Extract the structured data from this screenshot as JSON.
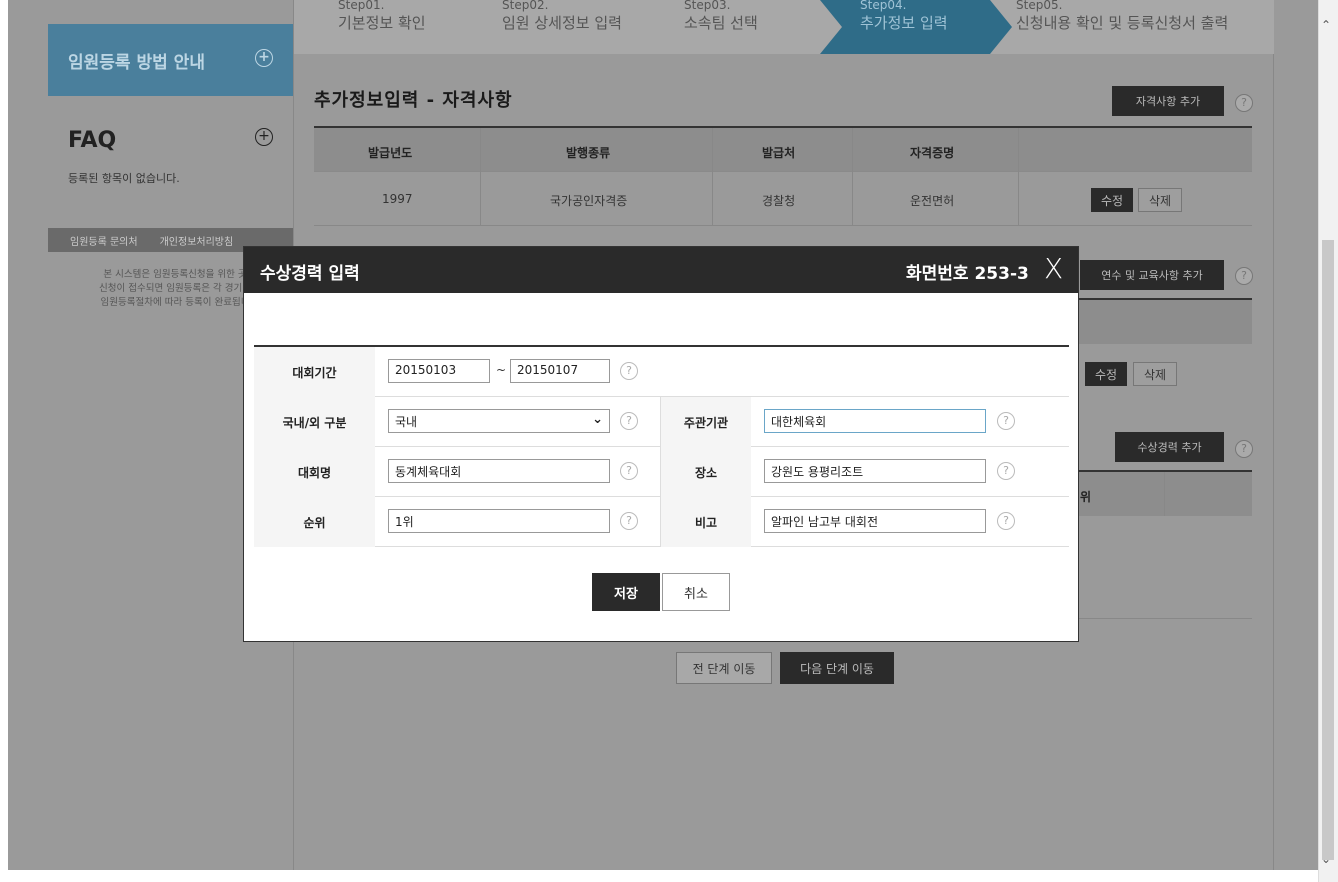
{
  "sidebar": {
    "guide_title": "임원등록 방법 안내",
    "faq_title": "FAQ",
    "faq_empty": "등록된 항목이 없습니다.",
    "links": [
      "임원등록 문의처",
      "개인정보처리방침"
    ],
    "notice_lines": [
      "본 시스템은 임원등록신청을 위한 곳",
      "신청이 접수되면 임원등록은 각 경기단",
      "임원등록절차에 따라 등록이 완료됩니"
    ]
  },
  "steps": [
    {
      "num": "Step01.",
      "label": "기본정보 확인",
      "active": false
    },
    {
      "num": "Step02.",
      "label": "임원 상세정보 입력",
      "active": false
    },
    {
      "num": "Step03.",
      "label": "소속팀 선택",
      "active": false
    },
    {
      "num": "Step04.",
      "label": "추가정보 입력",
      "active": true
    },
    {
      "num": "Step05.",
      "label": "신청내용 확인 및 등록신청서 출력",
      "active": false
    }
  ],
  "section": {
    "title": "추가정보입력 - 자격사항",
    "add_cert_button": "자격사항 추가",
    "add_training_button": "연수 및 교육사항 추가",
    "add_award_button": "수상경력 추가",
    "award_rank_header": "위"
  },
  "cert_table": {
    "headers": [
      "발급년도",
      "발행종류",
      "발급처",
      "자격증명"
    ],
    "rows": [
      [
        "1997",
        "국가공인자격증",
        "경찰청",
        "운전면허"
      ]
    ]
  },
  "row_actions": {
    "edit": "수정",
    "delete": "삭제"
  },
  "nav": {
    "prev": "전 단계 이동",
    "next": "다음 단계 이동"
  },
  "modal": {
    "title": "수상경력 입력",
    "screen_no": "화면번호 253-3",
    "close_glyph": "X",
    "labels": {
      "period": "대회기간",
      "domestic": "국내/외 구분",
      "host": "주관기관",
      "name": "대회명",
      "place": "장소",
      "rank": "순위",
      "note": "비고"
    },
    "values": {
      "period_start": "20150103",
      "period_end": "20150107",
      "tilde": "~",
      "domestic": "국내",
      "host": "대한체육회",
      "name": "동계체육대회",
      "place": "강원도 용평리조트",
      "rank": "1위",
      "note": "알파인 남고부 대회전"
    },
    "save": "저장",
    "cancel": "취소"
  }
}
